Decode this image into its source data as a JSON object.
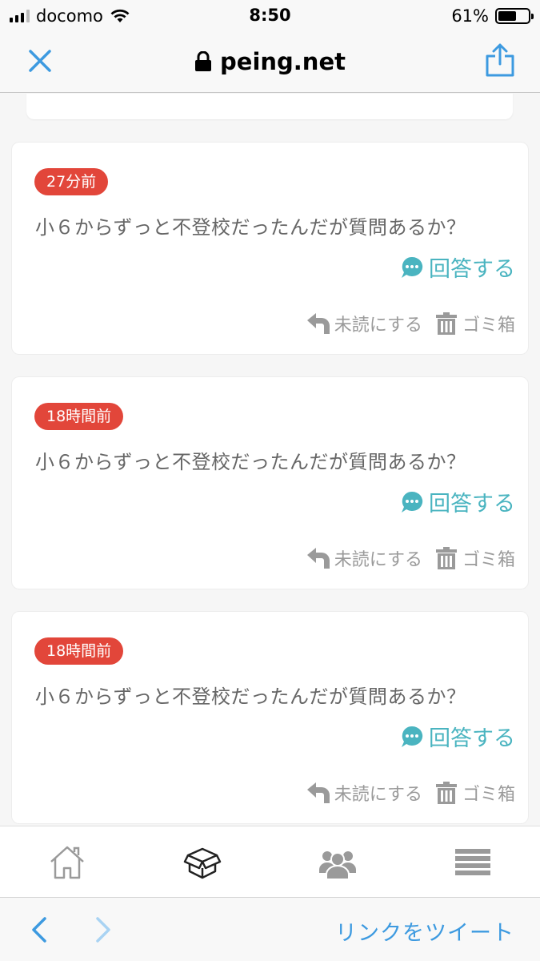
{
  "status_bar": {
    "carrier": "docomo",
    "time": "8:50",
    "battery": "61%",
    "battery_level": 0.61
  },
  "browser": {
    "url": "peing.net"
  },
  "questions": [
    {
      "time_ago": "27分前",
      "text": "小６からずっと不登校だったんだが質問あるか？",
      "answer_label": "回答する",
      "unread_label": "未読にする",
      "trash_label": "ゴミ箱"
    },
    {
      "time_ago": "18時間前",
      "text": "小６からずっと不登校だったんだが質問あるか？",
      "answer_label": "回答する",
      "unread_label": "未読にする",
      "trash_label": "ゴミ箱"
    },
    {
      "time_ago": "18時間前",
      "text": "小６からずっと不登校だったんだが質問あるか？",
      "answer_label": "回答する",
      "unread_label": "未読にする",
      "trash_label": "ゴミ箱"
    }
  ],
  "tab_bar": {
    "items": [
      "home-icon",
      "box-icon",
      "users-icon",
      "menu-icon"
    ]
  },
  "bottom_bar": {
    "tweet_link": "リンクをツイート"
  },
  "colors": {
    "badge": "#e2463a",
    "answer": "#4ab4c0",
    "link": "#3d9ae0",
    "muted": "#9a9a9a"
  }
}
